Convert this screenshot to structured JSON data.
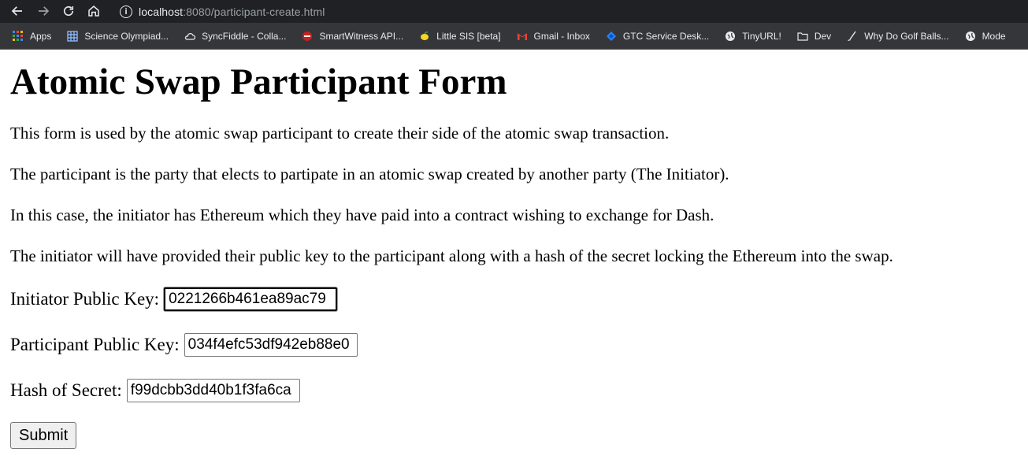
{
  "browser": {
    "url_host": "localhost",
    "url_rest": ":8080/participant-create.html",
    "bookmarks": [
      {
        "label": "Apps",
        "icon": "apps-grid-icon"
      },
      {
        "label": "Science Olympiad...",
        "icon": "grid-icon"
      },
      {
        "label": "SyncFiddle - Colla...",
        "icon": "cloud-icon"
      },
      {
        "label": "SmartWitness API...",
        "icon": "red-circle-icon"
      },
      {
        "label": "Little SIS [beta]",
        "icon": "lemon-icon"
      },
      {
        "label": "Gmail - Inbox",
        "icon": "gmail-icon"
      },
      {
        "label": "GTC Service Desk...",
        "icon": "jira-icon"
      },
      {
        "label": "TinyURL!",
        "icon": "globe-icon"
      },
      {
        "label": "Dev",
        "icon": "folder-icon"
      },
      {
        "label": "Why Do Golf Balls...",
        "icon": "golf-club-icon"
      },
      {
        "label": "Mode",
        "icon": "globe-icon"
      }
    ]
  },
  "page": {
    "title": "Atomic Swap Participant Form",
    "paragraphs": [
      "This form is used by the atomic swap participant to create their side of the atomic swap transaction.",
      "The participant is the party that elects to partipate in an atomic swap created by another party (The Initiator).",
      "In this case, the initiator has Ethereum which they have paid into a contract wishing to exchange for Dash.",
      "The initiator will have provided their public key to the participant along with a hash of the secret locking the Ethereum into the swap."
    ],
    "fields": {
      "initiator_label": "Initiator Public Key:",
      "initiator_value": "0221266b461ea89ac79",
      "participant_label": "Participant Public Key:",
      "participant_value": "034f4efc53df942eb88e0",
      "hash_label": "Hash of Secret:",
      "hash_value": "f99dcbb3dd40b1f3fa6ca"
    },
    "submit_label": "Submit"
  }
}
